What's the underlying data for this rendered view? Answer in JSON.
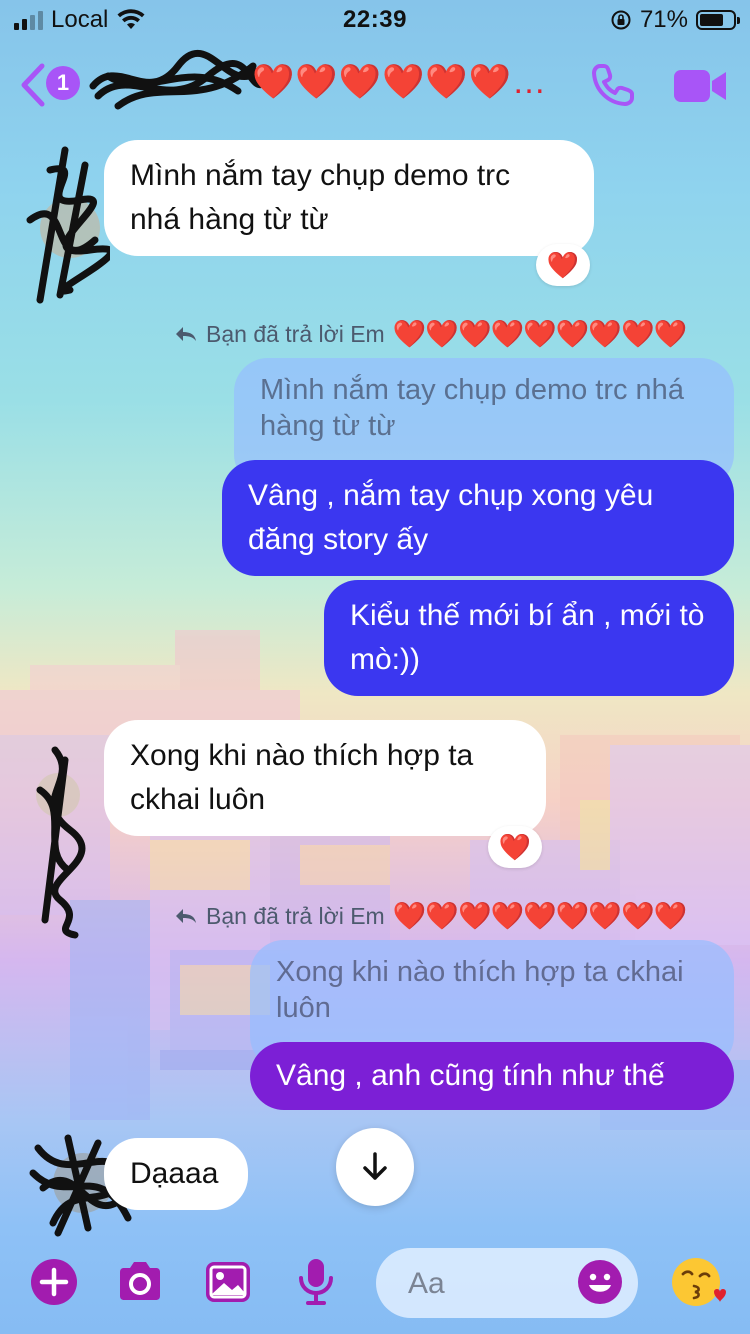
{
  "status_bar": {
    "carrier": "Local",
    "time": "22:39",
    "battery_percent": "71%",
    "signal_bars_active": 2,
    "battery_level": 0.71
  },
  "header": {
    "back_badge": "1",
    "contact_name": "❤️❤️❤️❤️❤️❤️…",
    "icons": [
      "chevron-left-icon",
      "phone-icon",
      "video-camera-icon"
    ]
  },
  "messages": [
    {
      "id": "m1",
      "side": "in",
      "text": "Mình nắm tay chụp demo trc nhá hàng từ từ",
      "reaction": "❤️"
    },
    {
      "id": "r1",
      "type": "reply_note",
      "text": "Bạn đã trả lời Em",
      "hearts": "❤️❤️❤️❤️❤️❤️❤️❤️❤️"
    },
    {
      "id": "q1",
      "side": "out",
      "type": "quote",
      "text": "Mình nắm tay chụp demo trc nhá hàng từ từ"
    },
    {
      "id": "m2",
      "side": "out",
      "text": "Vâng , nắm tay chụp xong yêu đăng story ấy"
    },
    {
      "id": "m3",
      "side": "out",
      "text": "Kiểu thế mới bí ẩn , mới tò mò:))"
    },
    {
      "id": "m4",
      "side": "in",
      "text": "Xong khi nào thích hợp ta ckhai luôn",
      "reaction": "❤️"
    },
    {
      "id": "r2",
      "type": "reply_note",
      "text": "Bạn đã trả lời Em",
      "hearts": "❤️❤️❤️❤️❤️❤️❤️❤️❤️"
    },
    {
      "id": "q2",
      "side": "out",
      "type": "quote",
      "text": "Xong khi nào thích hợp ta ckhai luôn"
    },
    {
      "id": "m5",
      "side": "out",
      "text": "Vâng , anh cũng tính như thế"
    },
    {
      "id": "m6",
      "side": "in",
      "text": "Dạaaa"
    }
  ],
  "composer": {
    "placeholder": "Aa",
    "icons": [
      "plus-icon",
      "camera-icon",
      "image-icon",
      "microphone-icon",
      "emoji-icon",
      "kissing-face-icon"
    ]
  },
  "colors": {
    "accent": "#a21caf",
    "outgoing_blue": "#3b37f0",
    "outgoing_purple": "#7c1fd6",
    "header_icons": "#a855f7",
    "heart": "#e0212e"
  }
}
